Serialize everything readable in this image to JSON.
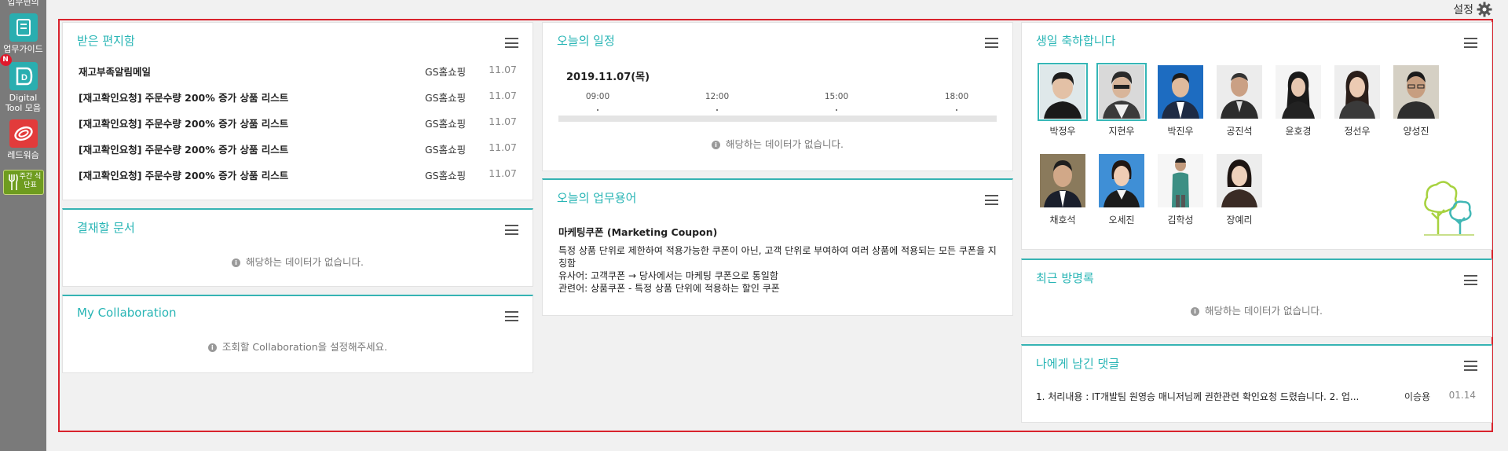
{
  "sidebar": {
    "items": [
      {
        "label": "업무편의"
      },
      {
        "label": "업무가이드"
      },
      {
        "label": "Digital Tool 모음",
        "badge": "N"
      },
      {
        "label": "레드워슴"
      },
      {
        "label": "주간 식단표"
      }
    ]
  },
  "settings": {
    "label": "설정"
  },
  "inbox": {
    "title": "받은 편지함",
    "rows": [
      {
        "subject": "재고부족알림메일",
        "sender": "GS홈쇼핑",
        "date": "11.07"
      },
      {
        "subject": "[재고확인요청] 주문수량 200% 증가 상품 리스트",
        "sender": "GS홈쇼핑",
        "date": "11.07"
      },
      {
        "subject": "[재고확인요청] 주문수량 200% 증가 상품 리스트",
        "sender": "GS홈쇼핑",
        "date": "11.07"
      },
      {
        "subject": "[재고확인요청] 주문수량 200% 증가 상품 리스트",
        "sender": "GS홈쇼핑",
        "date": "11.07"
      },
      {
        "subject": "[재고확인요청] 주문수량 200% 증가 상품 리스트",
        "sender": "GS홈쇼핑",
        "date": "11.07"
      }
    ]
  },
  "approval": {
    "title": "결재할 문서",
    "empty": "해당하는 데이터가 없습니다."
  },
  "collab": {
    "title": "My Collaboration",
    "empty": "조회할 Collaboration을 설정해주세요."
  },
  "schedule": {
    "title": "오늘의 일정",
    "date": "2019.11.07(목)",
    "ticks": [
      "09:00",
      "12:00",
      "15:00",
      "18:00"
    ],
    "empty": "해당하는 데이터가 없습니다."
  },
  "term": {
    "title": "오늘의 업무용어",
    "name": "마케팅쿠폰 (Marketing Coupon)",
    "lines": [
      "특정 상품 단위로 제한하여 적용가능한 쿠폰이 아닌, 고객 단위로 부여하여 여러 상품에 적용되는 모든 쿠폰을 지칭함",
      "유사어: 고객쿠폰 → 당사에서는 마케팅 쿠폰으로 통일함",
      "관련어: 상품쿠폰 - 특정 상품 단위에 적용하는 할인 쿠폰"
    ]
  },
  "birthday": {
    "title": "생일 축하합니다",
    "people": [
      {
        "name": "박정우"
      },
      {
        "name": "지현우"
      },
      {
        "name": "박진우"
      },
      {
        "name": "공진석"
      },
      {
        "name": "윤호경"
      },
      {
        "name": "정선우"
      },
      {
        "name": "양성진"
      },
      {
        "name": "채호석"
      },
      {
        "name": "오세진"
      },
      {
        "name": "김학성"
      },
      {
        "name": "장예리"
      }
    ]
  },
  "guestbook": {
    "title": "최근 방명록",
    "empty": "해당하는 데이터가 없습니다."
  },
  "comments": {
    "title": "나에게 남긴 댓글",
    "rows": [
      {
        "text": "1. 처리내용 : IT개발팀 원영승 매니저님께 권한관련 확인요청 드렸습니다. 2. 업...",
        "author": "이승용",
        "date": "01.14"
      }
    ]
  },
  "colors": {
    "accent": "#28b5b5",
    "frame": "#d9232d",
    "sidebar": "#7a7a7a"
  }
}
